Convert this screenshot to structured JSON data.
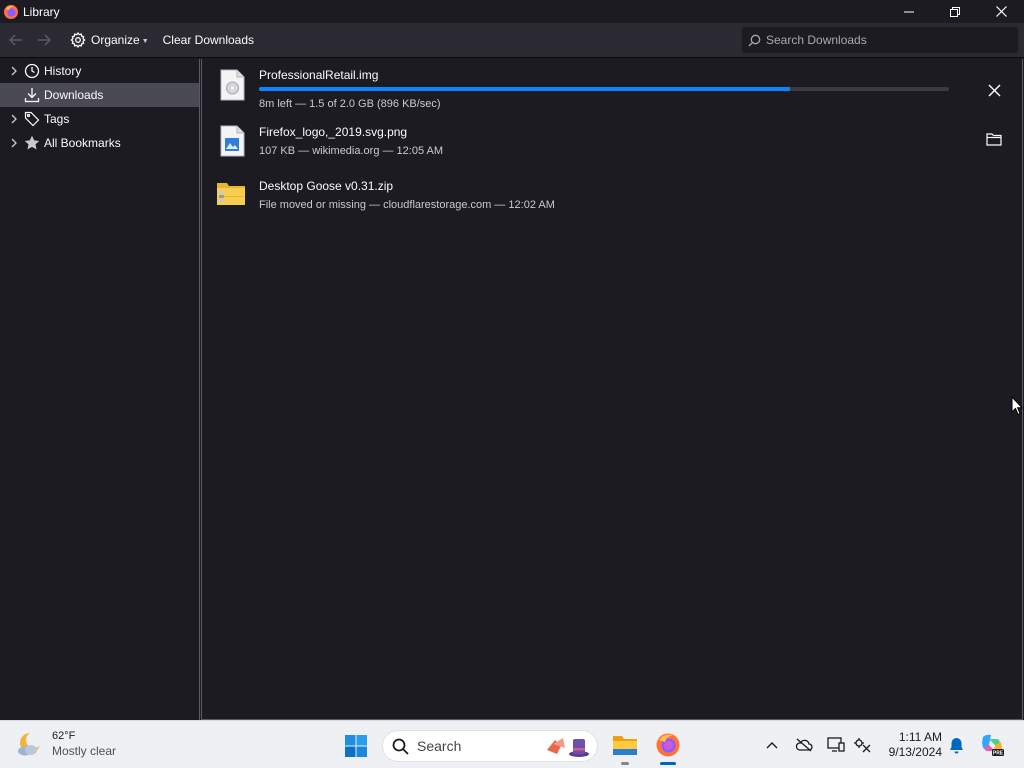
{
  "window": {
    "title": "Library"
  },
  "toolbar": {
    "organize_label": "Organize",
    "clear_label": "Clear Downloads",
    "search_placeholder": "Search Downloads"
  },
  "sidebar": {
    "items": [
      {
        "label": "History",
        "icon": "clock-icon",
        "expandable": true,
        "selected": false
      },
      {
        "label": "Downloads",
        "icon": "download-icon",
        "expandable": false,
        "selected": true
      },
      {
        "label": "Tags",
        "icon": "tag-icon",
        "expandable": true,
        "selected": false
      },
      {
        "label": "All Bookmarks",
        "icon": "star-icon",
        "expandable": true,
        "selected": false
      }
    ]
  },
  "downloads": [
    {
      "name": "ProfessionalRetail.img",
      "status": "8m left — 1.5 of 2.0 GB (896 KB/sec)",
      "progress": 0.77,
      "action": "cancel-icon",
      "file_icon": "disk-image-file-icon"
    },
    {
      "name": "Firefox_logo,_2019.svg.png",
      "status": "107 KB — wikimedia.org — 12:05 AM",
      "action": "folder-icon",
      "file_icon": "image-file-icon"
    },
    {
      "name": "Desktop Goose v0.31.zip",
      "status": "File moved or missing — cloudflarestorage.com — 12:02 AM",
      "file_icon": "zip-folder-icon"
    }
  ],
  "taskbar": {
    "weather": {
      "temp": "62°F",
      "desc": "Mostly clear",
      "icon": "moon-cloud-icon"
    },
    "search_label": "Search",
    "clock": {
      "time": "1:11 AM",
      "date": "9/13/2024"
    },
    "pinned": [
      "windows-start-icon",
      "file-explorer-icon",
      "firefox-icon"
    ],
    "tray": [
      "chevron-up-icon",
      "cloud-offline-icon",
      "display-icon",
      "settings-status-icon",
      "bell-icon",
      "copilot-icon"
    ]
  },
  "colors": {
    "accent": "#0a84ff",
    "sidebar_selected": "#4a4a55",
    "background": "#1c1b22",
    "toolbar": "#2b2a33"
  }
}
